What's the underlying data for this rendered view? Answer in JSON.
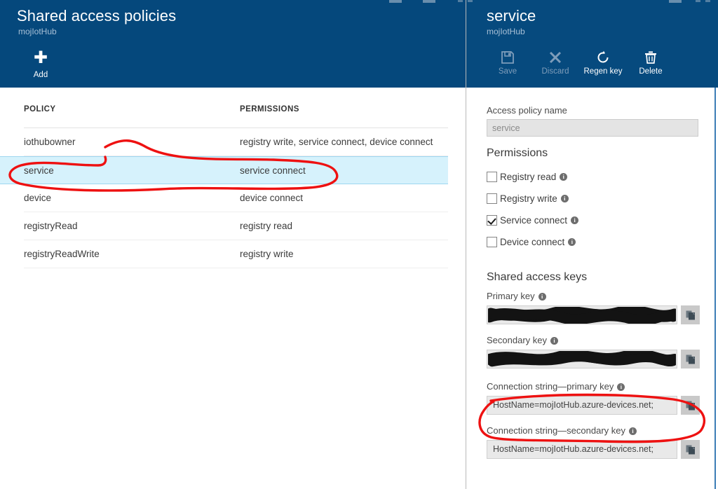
{
  "left_blade": {
    "title": "Shared access policies",
    "subtitle": "mojIotHub",
    "commands": [
      {
        "label": "Add",
        "icon": "plus-icon",
        "disabled": false
      }
    ],
    "table": {
      "columns": [
        "POLICY",
        "PERMISSIONS"
      ],
      "rows": [
        {
          "policy": "iothubowner",
          "permissions": "registry write, service connect, device connect",
          "selected": false
        },
        {
          "policy": "service",
          "permissions": "service connect",
          "selected": true
        },
        {
          "policy": "device",
          "permissions": "device connect",
          "selected": false
        },
        {
          "policy": "registryRead",
          "permissions": "registry read",
          "selected": false
        },
        {
          "policy": "registryReadWrite",
          "permissions": "registry write",
          "selected": false
        }
      ]
    }
  },
  "right_blade": {
    "title": "service",
    "subtitle": "mojIotHub",
    "commands": [
      {
        "label": "Save",
        "icon": "save-icon",
        "disabled": true
      },
      {
        "label": "Discard",
        "icon": "close-icon",
        "disabled": true
      },
      {
        "label": "Regen key",
        "icon": "refresh-icon",
        "disabled": false
      },
      {
        "label": "Delete",
        "icon": "trash-icon",
        "disabled": false
      }
    ],
    "access_policy_name": {
      "label": "Access policy name",
      "value": "service"
    },
    "permissions": {
      "title": "Permissions",
      "items": [
        {
          "label": "Registry read",
          "checked": false,
          "info": "i"
        },
        {
          "label": "Registry write",
          "checked": false,
          "info": "i"
        },
        {
          "label": "Service connect",
          "checked": true,
          "info": "i"
        },
        {
          "label": "Device connect",
          "checked": false,
          "info": "i"
        }
      ]
    },
    "shared_access_keys": {
      "title": "Shared access keys",
      "fields": [
        {
          "label": "Primary key",
          "value": "",
          "redacted": true,
          "info": "i",
          "copy": "copy-icon"
        },
        {
          "label": "Secondary key",
          "value": "",
          "redacted": true,
          "info": "i",
          "copy": "copy-icon"
        },
        {
          "label": "Connection string—primary key",
          "value": "HostName=mojIotHub.azure-devices.net;",
          "redacted": false,
          "info": "i",
          "copy": "copy-icon"
        },
        {
          "label": "Connection string—secondary key",
          "value": "HostName=mojIotHub.azure-devices.net;",
          "redacted": false,
          "info": "i",
          "copy": "copy-icon"
        }
      ]
    }
  },
  "colors": {
    "header_blue": "#05487c",
    "selected_row": "#d6f2fc",
    "selected_border": "#9ed6f0",
    "annotation_red": "#ee1111",
    "copy_button": "#c9c9c9"
  },
  "annotations": [
    {
      "name": "circle-service-row",
      "color": "#ee1111"
    },
    {
      "name": "circle-connection-string-primary",
      "color": "#ee1111"
    }
  ]
}
